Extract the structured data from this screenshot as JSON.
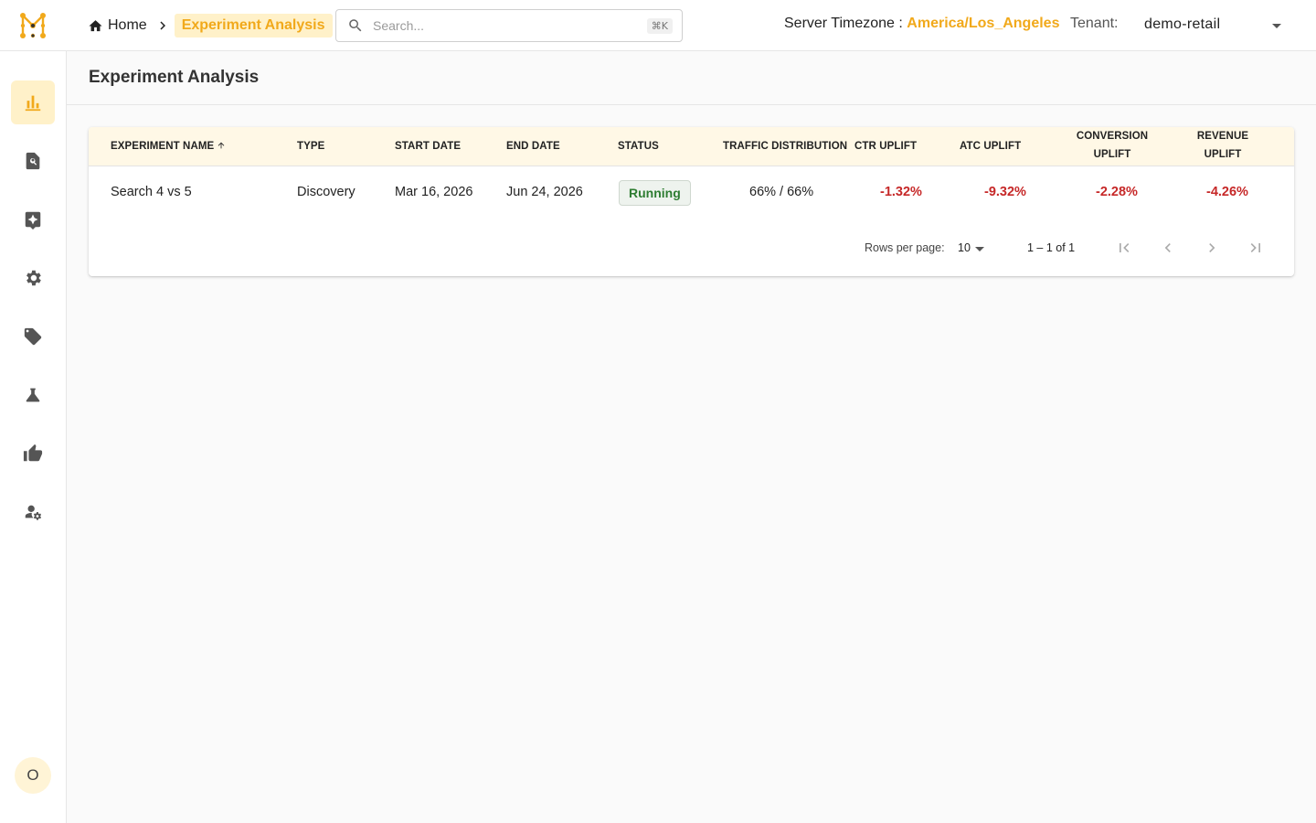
{
  "colors": {
    "accent": "#f1a91b",
    "accent_bg": "#fff1c9",
    "negative": "#c62828",
    "success": "#2e7d32"
  },
  "header": {
    "breadcrumb": {
      "home_label": "Home",
      "current_label": "Experiment Analysis"
    },
    "search": {
      "placeholder": "Search...",
      "value": "",
      "shortcut": "⌘K"
    },
    "timezone": {
      "label": "Server Timezone :",
      "value": "America/Los_Angeles"
    },
    "tenant": {
      "label": "Tenant:",
      "value": "demo-retail"
    }
  },
  "sidebar": {
    "items": [
      {
        "icon": "bar-chart-icon",
        "active": true
      },
      {
        "icon": "search-document-icon",
        "active": false
      },
      {
        "icon": "sparkle-box-icon",
        "active": false
      },
      {
        "icon": "gear-icon",
        "active": false
      },
      {
        "icon": "tag-icon",
        "active": false
      },
      {
        "icon": "flask-icon",
        "active": false
      },
      {
        "icon": "thumbs-up-icon",
        "active": false
      },
      {
        "icon": "user-settings-icon",
        "active": false
      }
    ],
    "avatar_initial": "O"
  },
  "page": {
    "title": "Experiment Analysis"
  },
  "table": {
    "columns": {
      "name": "Experiment Name",
      "type": "Type",
      "start": "Start Date",
      "end": "End Date",
      "status": "Status",
      "traffic": "Traffic Distribution",
      "ctr": "CTR Uplift",
      "atc": "ATC Uplift",
      "conversion_1": "Conversion",
      "conversion_2": "Uplift",
      "revenue_1": "Revenue",
      "revenue_2": "Uplift"
    },
    "rows": [
      {
        "name": "Search 4 vs 5",
        "type": "Discovery",
        "start": "Mar 16, 2026",
        "end": "Jun 24, 2026",
        "status": "Running",
        "traffic": "66% / 66%",
        "ctr": "-1.32%",
        "atc": "-9.32%",
        "conversion": "-2.28%",
        "revenue": "-4.26%"
      }
    ],
    "pagination": {
      "rows_per_page_label": "Rows per page:",
      "rows_per_page": "10",
      "range": "1 – 1 of 1"
    }
  }
}
